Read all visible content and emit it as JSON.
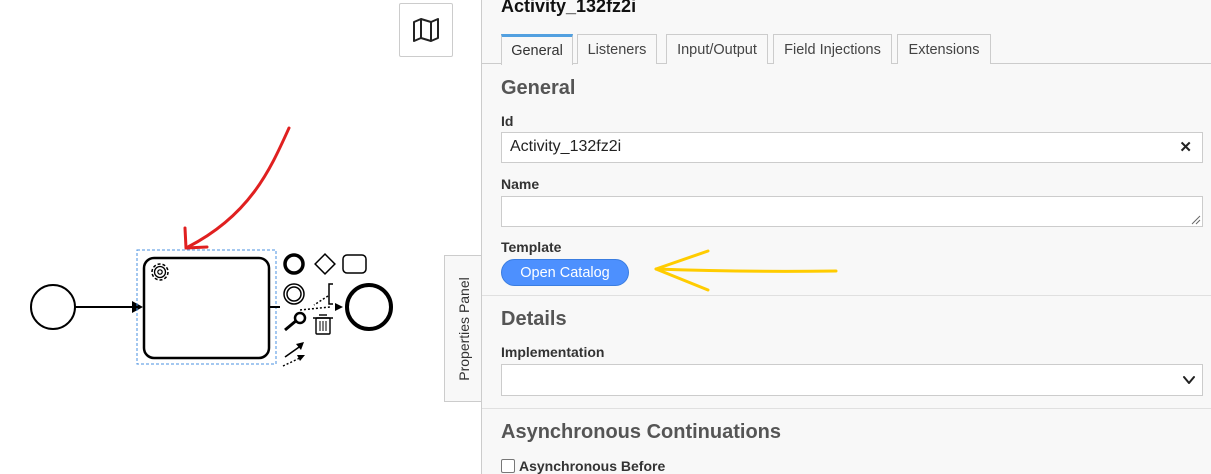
{
  "canvas": {
    "toggle_label": "Properties Panel",
    "icons": {
      "minimap": "map-icon",
      "task_marker": "gear-icon",
      "delete": "trash-icon"
    },
    "annotation_colors": {
      "red_arrow": "#e02020",
      "yellow_arrow": "#ffcc00"
    }
  },
  "panel": {
    "header": "Activity_132fz2i",
    "tabs": [
      {
        "label": "General"
      },
      {
        "label": "Listeners"
      },
      {
        "label": "Input/Output"
      },
      {
        "label": "Field Injections"
      },
      {
        "label": "Extensions"
      }
    ],
    "general": {
      "title": "General",
      "id_label": "Id",
      "id_value": "Activity_132fz2i",
      "name_label": "Name",
      "name_value": "",
      "template_label": "Template",
      "catalog_button": "Open Catalog"
    },
    "details": {
      "title": "Details",
      "implementation_label": "Implementation",
      "implementation_value": ""
    },
    "async": {
      "title": "Asynchronous Continuations",
      "before_label": "Asynchronous Before"
    }
  },
  "colors": {
    "accent": "#4d90fe",
    "tab_active_border": "#52a0e0",
    "panel_bg": "#f8f8f8"
  }
}
